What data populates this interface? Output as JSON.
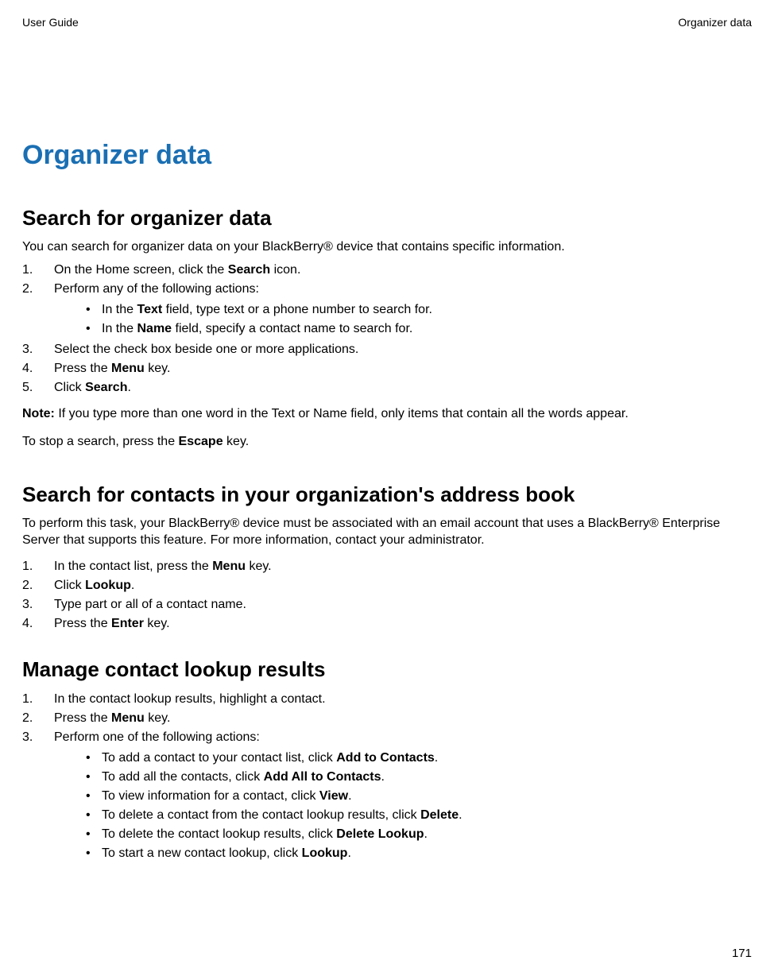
{
  "header": {
    "left": "User Guide",
    "right": "Organizer data"
  },
  "title": "Organizer data",
  "sections": {
    "search_organizer": {
      "heading": "Search for organizer data",
      "intro": "You can search for organizer data on your BlackBerry® device that contains specific information.",
      "steps": {
        "s1_pre": "On the Home screen, click the ",
        "s1_bold": "Search",
        "s1_post": " icon.",
        "s2": "Perform any of the following actions:",
        "s2_b1_pre": "In the ",
        "s2_b1_bold": "Text",
        "s2_b1_post": " field, type text or a phone number to search for.",
        "s2_b2_pre": "In the ",
        "s2_b2_bold": "Name",
        "s2_b2_post": " field, specify a contact name to search for.",
        "s3": "Select the check box beside one or more applications.",
        "s4_pre": "Press the ",
        "s4_bold": "Menu",
        "s4_post": " key.",
        "s5_pre": "Click ",
        "s5_bold": "Search",
        "s5_post": "."
      },
      "note_label": "Note:",
      "note_body": "  If you type more than one word in the Text or Name field, only items that contain all the words appear.",
      "stop_pre": "To stop a search, press the ",
      "stop_bold": "Escape",
      "stop_post": " key."
    },
    "search_contacts": {
      "heading": "Search for contacts in your organization's address book",
      "intro": "To perform this task, your BlackBerry® device must be associated with an email account that uses a BlackBerry® Enterprise Server that supports this feature. For more information, contact your administrator.",
      "s1_pre": "In the contact list, press the ",
      "s1_bold": "Menu",
      "s1_post": " key.",
      "s2_pre": "Click ",
      "s2_bold": "Lookup",
      "s2_post": ".",
      "s3": "Type part or all of a contact name.",
      "s4_pre": "Press the ",
      "s4_bold": "Enter",
      "s4_post": " key."
    },
    "manage_results": {
      "heading": "Manage contact lookup results",
      "s1": "In the contact lookup results, highlight a contact.",
      "s2_pre": "Press the ",
      "s2_bold": "Menu",
      "s2_post": " key.",
      "s3": "Perform one of the following actions:",
      "b1_pre": "To add a contact to your contact list, click ",
      "b1_bold": "Add to Contacts",
      "b1_post": ".",
      "b2_pre": "To add all the contacts, click ",
      "b2_bold": "Add All to Contacts",
      "b2_post": ".",
      "b3_pre": "To view information for a contact, click ",
      "b3_bold": "View",
      "b3_post": ".",
      "b4_pre": "To delete a contact from the contact lookup results, click ",
      "b4_bold": "Delete",
      "b4_post": ".",
      "b5_pre": "To delete the contact lookup results, click ",
      "b5_bold": "Delete Lookup",
      "b5_post": ".",
      "b6_pre": "To start a new contact lookup, click ",
      "b6_bold": "Lookup",
      "b6_post": "."
    }
  },
  "page_number": "171",
  "nums": {
    "n1": "1.",
    "n2": "2.",
    "n3": "3.",
    "n4": "4.",
    "n5": "5."
  }
}
